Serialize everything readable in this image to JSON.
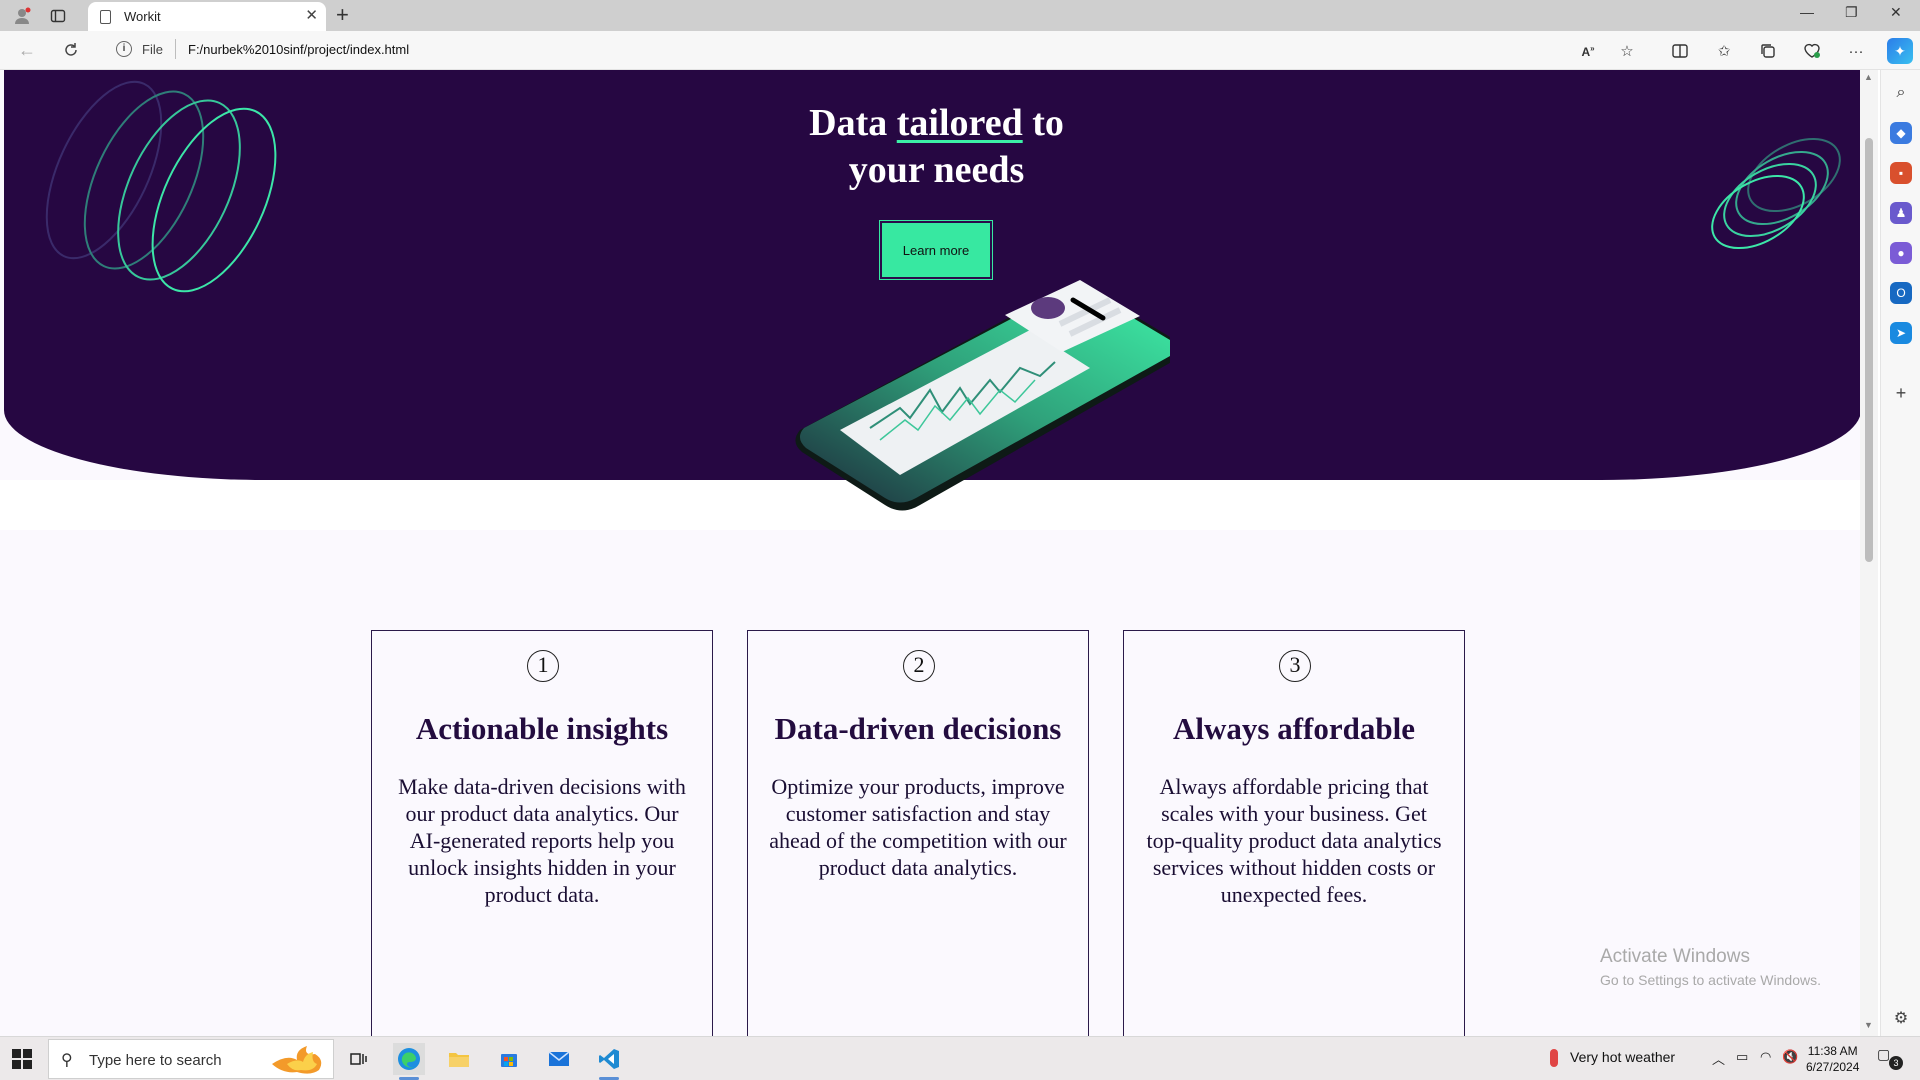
{
  "browser": {
    "tab_title": "Workit",
    "new_tab_label": "+",
    "address_scheme_label": "File",
    "url": "F:/nurbek%2010sinf/project/index.html"
  },
  "hero": {
    "title_word1": "Data",
    "title_word2": "tailored",
    "title_word3": "to",
    "title_line2": "your needs",
    "cta_label": "Learn more"
  },
  "cards": [
    {
      "number": "1",
      "title": "Actionable insights",
      "text": "Make data-driven decisions with our product data analytics. Our AI-generated reports help you unlock insights hidden in your product data."
    },
    {
      "number": "2",
      "title": "Data-driven decisions",
      "text": "Optimize your products, improve customer satisfaction and stay ahead of the competition with our product data analytics."
    },
    {
      "number": "3",
      "title": "Always affordable",
      "text": "Always affordable pricing that scales with your business. Get top-quality product data analytics services without hidden costs or unexpected fees."
    }
  ],
  "watermark": {
    "line1": "Activate Windows",
    "line2": "Go to Settings to activate Windows."
  },
  "taskbar": {
    "search_placeholder": "Type here to search",
    "weather": "Very hot weather",
    "time": "11:38 AM",
    "date": "6/27/2024",
    "notification_count": "3"
  },
  "colors": {
    "hero_bg": "#260742",
    "accent": "#37e8a1",
    "card_border": "#2b1a4a",
    "page_bg": "#fbf9fe"
  }
}
